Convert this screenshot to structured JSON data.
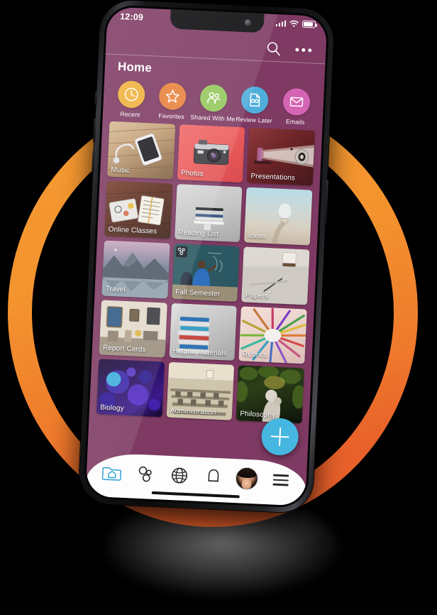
{
  "status_bar": {
    "time": "12:09",
    "signal_icon": "signal-bars-icon",
    "wifi_icon": "wifi-icon",
    "battery_icon": "battery-icon"
  },
  "header": {
    "title": "Home",
    "search_icon": "search-icon",
    "more_icon": "more-options-icon"
  },
  "quick_access": [
    {
      "label": "Recent",
      "icon": "clock-icon",
      "color": "#EFB13C"
    },
    {
      "label": "Favorites",
      "icon": "star-icon",
      "color": "#E8823C"
    },
    {
      "label": "Shared With Me",
      "icon": "people-icon",
      "color": "#95C75C"
    },
    {
      "label": "Review Later",
      "icon": "document-icon",
      "color": "#4FAEDC"
    },
    {
      "label": "Emails",
      "icon": "envelope-icon",
      "color": "#D664B4"
    }
  ],
  "tiles": [
    {
      "label": "Music",
      "badge": null
    },
    {
      "label": "Photos",
      "badge": null
    },
    {
      "label": "Presentations",
      "badge": null
    },
    {
      "label": "Online Classes",
      "badge": null
    },
    {
      "label": "Reading List",
      "badge": null
    },
    {
      "label": "Ideas",
      "badge": null
    },
    {
      "label": "Travel",
      "badge": null
    },
    {
      "label": "Fall Semester",
      "badge": "shared-badge-icon"
    },
    {
      "label": "Papers",
      "badge": null
    },
    {
      "label": "Report Cards",
      "badge": null
    },
    {
      "label": "Helpful Materials",
      "badge": null
    },
    {
      "label": "Rubrics",
      "badge": null
    },
    {
      "label": "Biology",
      "badge": null
    },
    {
      "label": "Administration",
      "badge": null
    },
    {
      "label": "Philosophy",
      "badge": null
    }
  ],
  "fab": {
    "icon": "plus-icon",
    "color": "#45B7E0"
  },
  "bottom_nav": [
    {
      "name": "home-folder-icon",
      "active": true
    },
    {
      "name": "connections-icon",
      "active": false
    },
    {
      "name": "globe-icon",
      "active": false
    },
    {
      "name": "bell-icon",
      "active": false
    },
    {
      "name": "profile-avatar",
      "active": false
    },
    {
      "name": "hamburger-menu-icon",
      "active": false
    }
  ],
  "theme": {
    "app_background": "#7E3A63",
    "ring_color_top": "#F4982F",
    "ring_color_bottom": "#E8652A",
    "page_background": "#000000",
    "accent": "#45B7E0"
  }
}
